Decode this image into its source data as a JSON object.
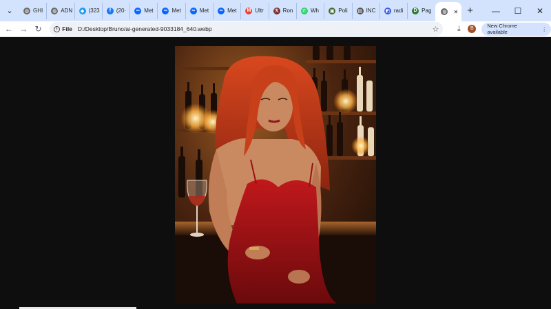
{
  "tabs": [
    {
      "label": "GHI",
      "icon": "globe-icon",
      "color": "#6b6b6b",
      "glyph": "◍"
    },
    {
      "label": "ADN",
      "icon": "globe-icon",
      "color": "#6b6b6b",
      "glyph": "◍"
    },
    {
      "label": "(323",
      "icon": "bird-icon",
      "color": "#1d9bf0",
      "glyph": "◆"
    },
    {
      "label": "(20·",
      "icon": "facebook-icon",
      "color": "#1877f2",
      "glyph": "f"
    },
    {
      "label": "Met",
      "icon": "meta-icon",
      "color": "#0866ff",
      "glyph": "∞"
    },
    {
      "label": "Met",
      "icon": "meta-icon",
      "color": "#0866ff",
      "glyph": "∞"
    },
    {
      "label": "Met",
      "icon": "meta-icon",
      "color": "#0866ff",
      "glyph": "∞"
    },
    {
      "label": "Met",
      "icon": "meta-icon",
      "color": "#0866ff",
      "glyph": "∞"
    },
    {
      "label": "Ultr",
      "icon": "gmail-icon",
      "color": "#ea4335",
      "glyph": "M"
    },
    {
      "label": "Ron",
      "icon": "ronin-icon",
      "color": "#7a2a2a",
      "glyph": "ℛ"
    },
    {
      "label": "Wh",
      "icon": "whatsapp-icon",
      "color": "#25d366",
      "glyph": "✆"
    },
    {
      "label": "Poli",
      "icon": "shield-icon",
      "color": "#4a6b2f",
      "glyph": "▣"
    },
    {
      "label": "INC",
      "icon": "document-icon",
      "color": "#555555",
      "glyph": "▤"
    },
    {
      "label": "radi",
      "icon": "radio-icon",
      "color": "#3b5bdb",
      "glyph": "◩"
    },
    {
      "label": "Pag",
      "icon": "page-icon",
      "color": "#2e7d32",
      "glyph": "D"
    }
  ],
  "active_tab": {
    "icon": "globe-icon",
    "close": "✕"
  },
  "new_tab": "+",
  "window_controls": {
    "minimize": "—",
    "maximize": "☐",
    "close": "✕"
  },
  "toolbar": {
    "back": "←",
    "forward": "→",
    "reload": "↻",
    "file_chip": "File",
    "url": "D:/Desktop/Bruno/ai-generated-9033184_640.webp",
    "bookmark": "☆",
    "download": "⤓",
    "avatar": "B",
    "update_label": "New Chrome available",
    "menu": "⋮"
  }
}
